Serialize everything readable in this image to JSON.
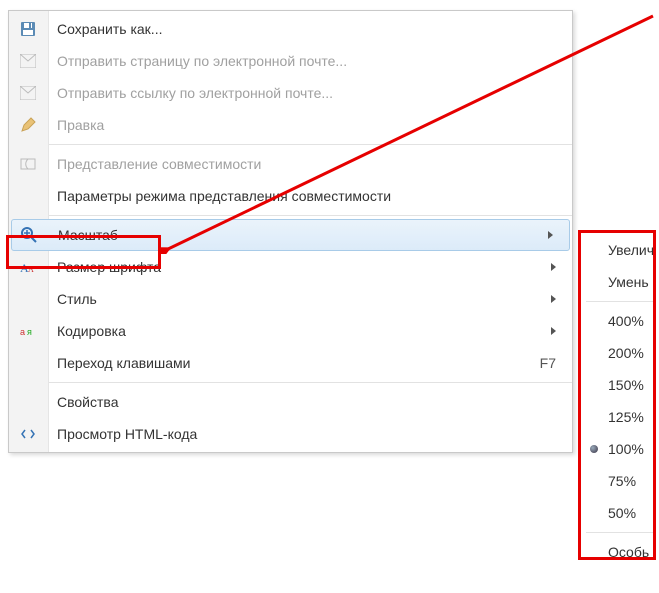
{
  "main_menu": {
    "save_as": "Сохранить как...",
    "send_page": "Отправить страницу по электронной почте...",
    "send_link": "Отправить ссылку по электронной почте...",
    "edit": "Правка",
    "compat_view": "Представление совместимости",
    "compat_settings": "Параметры режима представления совместимости",
    "zoom": "Масштаб",
    "font_size": "Размер шрифта",
    "style": "Стиль",
    "encoding": "Кодировка",
    "caret": "Переход клавишами",
    "caret_shortcut": "F7",
    "properties": "Свойства",
    "view_source": "Просмотр HTML-кода"
  },
  "zoom_submenu": {
    "zoom_in": "Увелич",
    "zoom_out": "Умень",
    "z400": "400%",
    "z200": "200%",
    "z150": "150%",
    "z125": "125%",
    "z100": "100%",
    "z75": "75%",
    "z50": "50%",
    "custom": "Особь"
  }
}
